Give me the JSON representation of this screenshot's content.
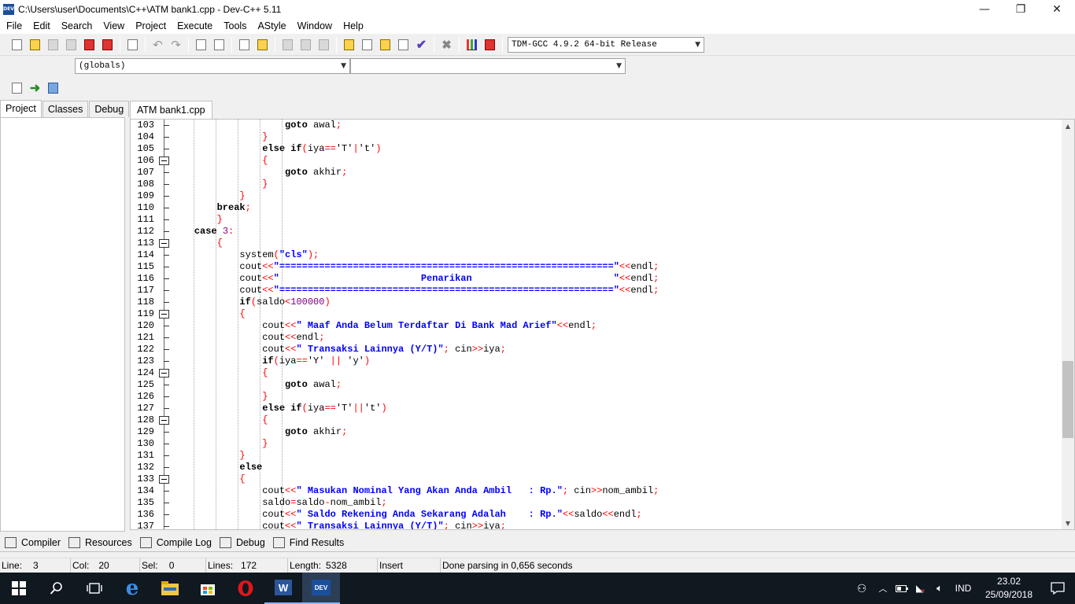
{
  "window": {
    "title": "C:\\Users\\user\\Documents\\C++\\ATM bank1.cpp - Dev-C++ 5.11",
    "icon_label": "DEV",
    "min": "—",
    "max": "❐",
    "close": "✕"
  },
  "menu": [
    "File",
    "Edit",
    "Search",
    "View",
    "Project",
    "Execute",
    "Tools",
    "AStyle",
    "Window",
    "Help"
  ],
  "compiler_select": "TDM-GCC 4.9.2 64-bit Release",
  "scope_select": "(globals)",
  "member_select": "",
  "left_tabs": [
    "Project",
    "Classes",
    "Debug"
  ],
  "editor_tab": "ATM bank1.cpp",
  "line_numbers": [
    "103",
    "104",
    "105",
    "106",
    "107",
    "108",
    "109",
    "110",
    "111",
    "112",
    "113",
    "114",
    "115",
    "116",
    "117",
    "118",
    "119",
    "120",
    "121",
    "122",
    "123",
    "124",
    "125",
    "126",
    "127",
    "128",
    "129",
    "130",
    "131",
    "132",
    "133",
    "134",
    "135",
    "136",
    "137"
  ],
  "code_lines": [
    "                    goto awal;",
    "                }",
    "                else if(iya=='T'|'t')",
    "                {",
    "                    goto akhir;",
    "                }",
    "            }",
    "        break;",
    "        }",
    "    case 3:",
    "        {",
    "            system(\"cls\");",
    "            cout<<\"===========================================================\"<<endl;",
    "            cout<<\"                         Penarikan                         \"<<endl;",
    "            cout<<\"===========================================================\"<<endl;",
    "            if(saldo<100000)",
    "            {",
    "                cout<<\" Maaf Anda Belum Terdaftar Di Bank Mad Arief\"<<endl;",
    "                cout<<endl;",
    "                cout<<\" Transaksi Lainnya (Y/T)\"; cin>>iya;",
    "                if(iya=='Y' || 'y')",
    "                {",
    "                    goto awal;",
    "                }",
    "                else if(iya=='T'||'t')",
    "                {",
    "                    goto akhir;",
    "                }",
    "            }",
    "            else",
    "            {",
    "                cout<<\" Masukan Nominal Yang Akan Anda Ambil   : Rp.\"; cin>>nom_ambil;",
    "                saldo=saldo-nom_ambil;",
    "                cout<<\" Saldo Rekening Anda Sekarang Adalah    : Rp.\"<<saldo<<endl;",
    "                cout<<\" Transaksi Lainnya (Y/T)\"; cin>>iya;"
  ],
  "bottom_tabs": [
    "Compiler",
    "Resources",
    "Compile Log",
    "Debug",
    "Find Results"
  ],
  "status": {
    "line_label": "Line:",
    "line": "3",
    "col_label": "Col:",
    "col": "20",
    "sel_label": "Sel:",
    "sel": "0",
    "lines_label": "Lines:",
    "lines": "172",
    "length_label": "Length:",
    "length": "5328",
    "mode": "Insert",
    "message": "Done parsing in 0,656 seconds"
  },
  "taskbar": {
    "lang": "IND",
    "time": "23.02",
    "date": "25/09/2018",
    "word_label": "W",
    "devcpp_label": "DEV"
  }
}
